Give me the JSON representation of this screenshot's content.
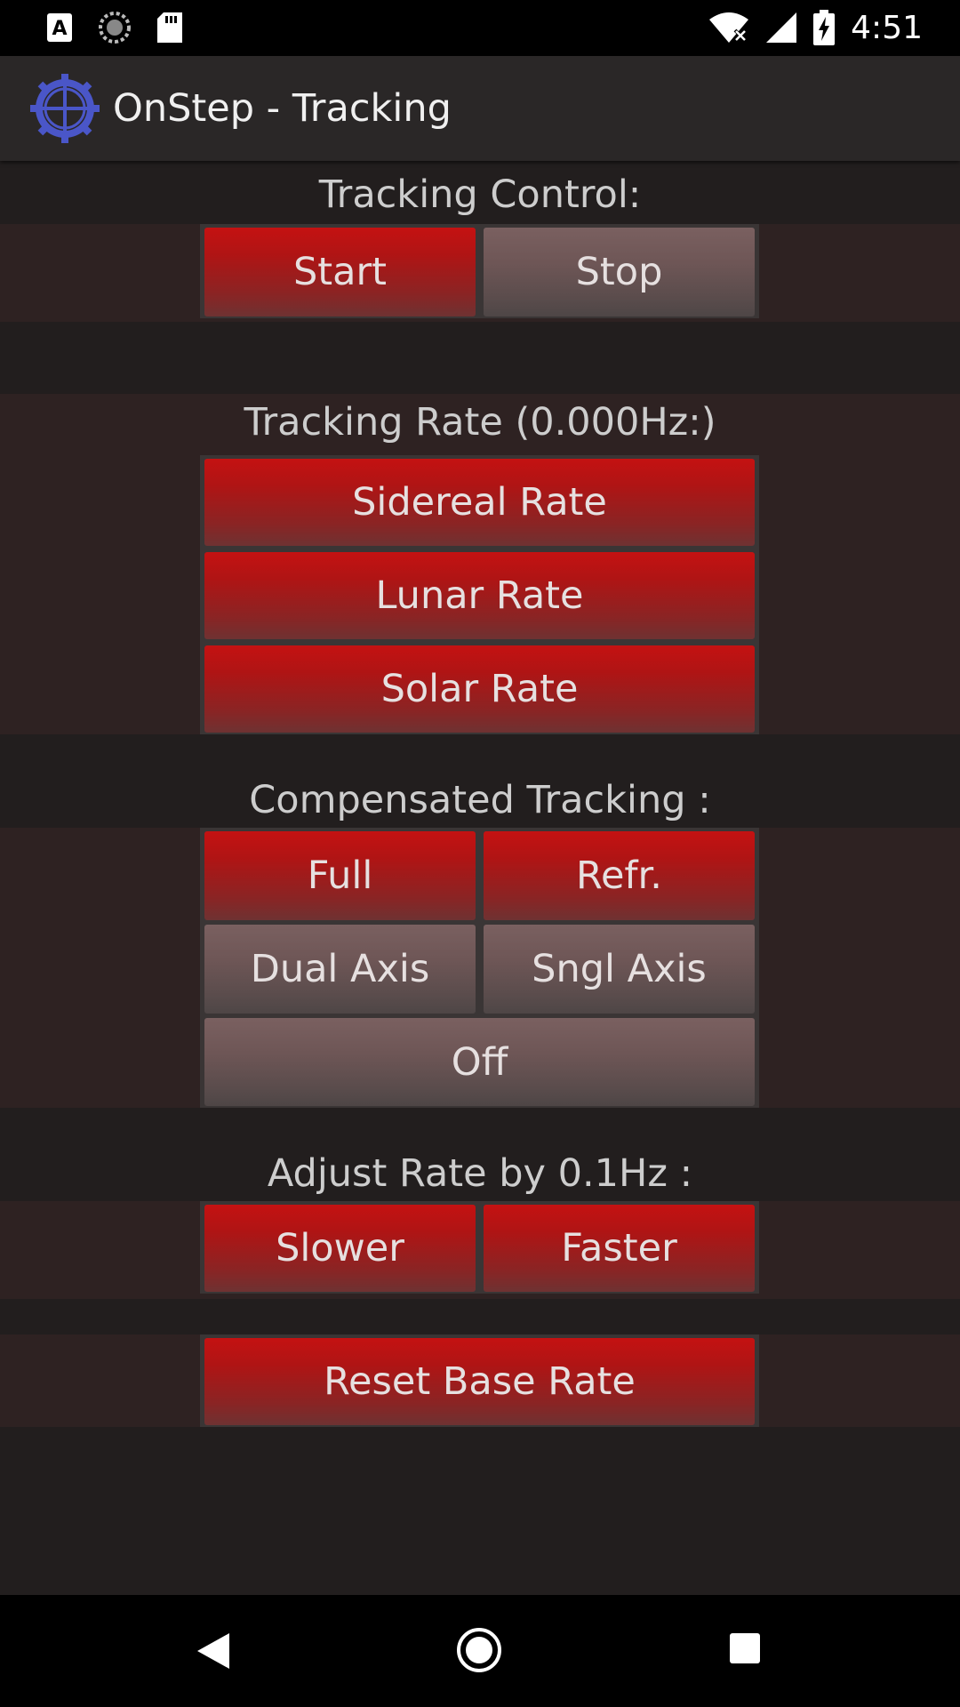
{
  "status_bar": {
    "time": "4:51",
    "left_icons": [
      "a-notification-icon",
      "sync-icon",
      "sd-card-icon"
    ],
    "right_icons": [
      "wifi-off-icon",
      "cell-signal-icon",
      "battery-charging-icon"
    ]
  },
  "app_bar": {
    "title": "OnStep - Tracking",
    "logo_color": "#4a56c8"
  },
  "tracking_control": {
    "title": "Tracking Control:",
    "start_label": "Start",
    "stop_label": "Stop"
  },
  "tracking_rate": {
    "title": "Tracking Rate (0.000Hz:)",
    "sidereal_label": "Sidereal Rate",
    "lunar_label": "Lunar Rate",
    "solar_label": "Solar Rate"
  },
  "compensated": {
    "title": "Compensated Tracking :",
    "full_label": "Full",
    "refr_label": "Refr.",
    "dual_label": "Dual Axis",
    "sngl_label": "Sngl Axis",
    "off_label": "Off"
  },
  "adjust": {
    "title": "Adjust Rate by 0.1Hz :",
    "slower_label": "Slower",
    "faster_label": "Faster"
  },
  "reset": {
    "label": "Reset Base Rate"
  },
  "colors": {
    "active_red": "#c41212",
    "inactive_gray": "#6e5656",
    "background": "#221e1e",
    "band": "#2e2222"
  },
  "nav_bar": {
    "icons": [
      "back-icon",
      "home-icon",
      "recents-icon"
    ]
  }
}
